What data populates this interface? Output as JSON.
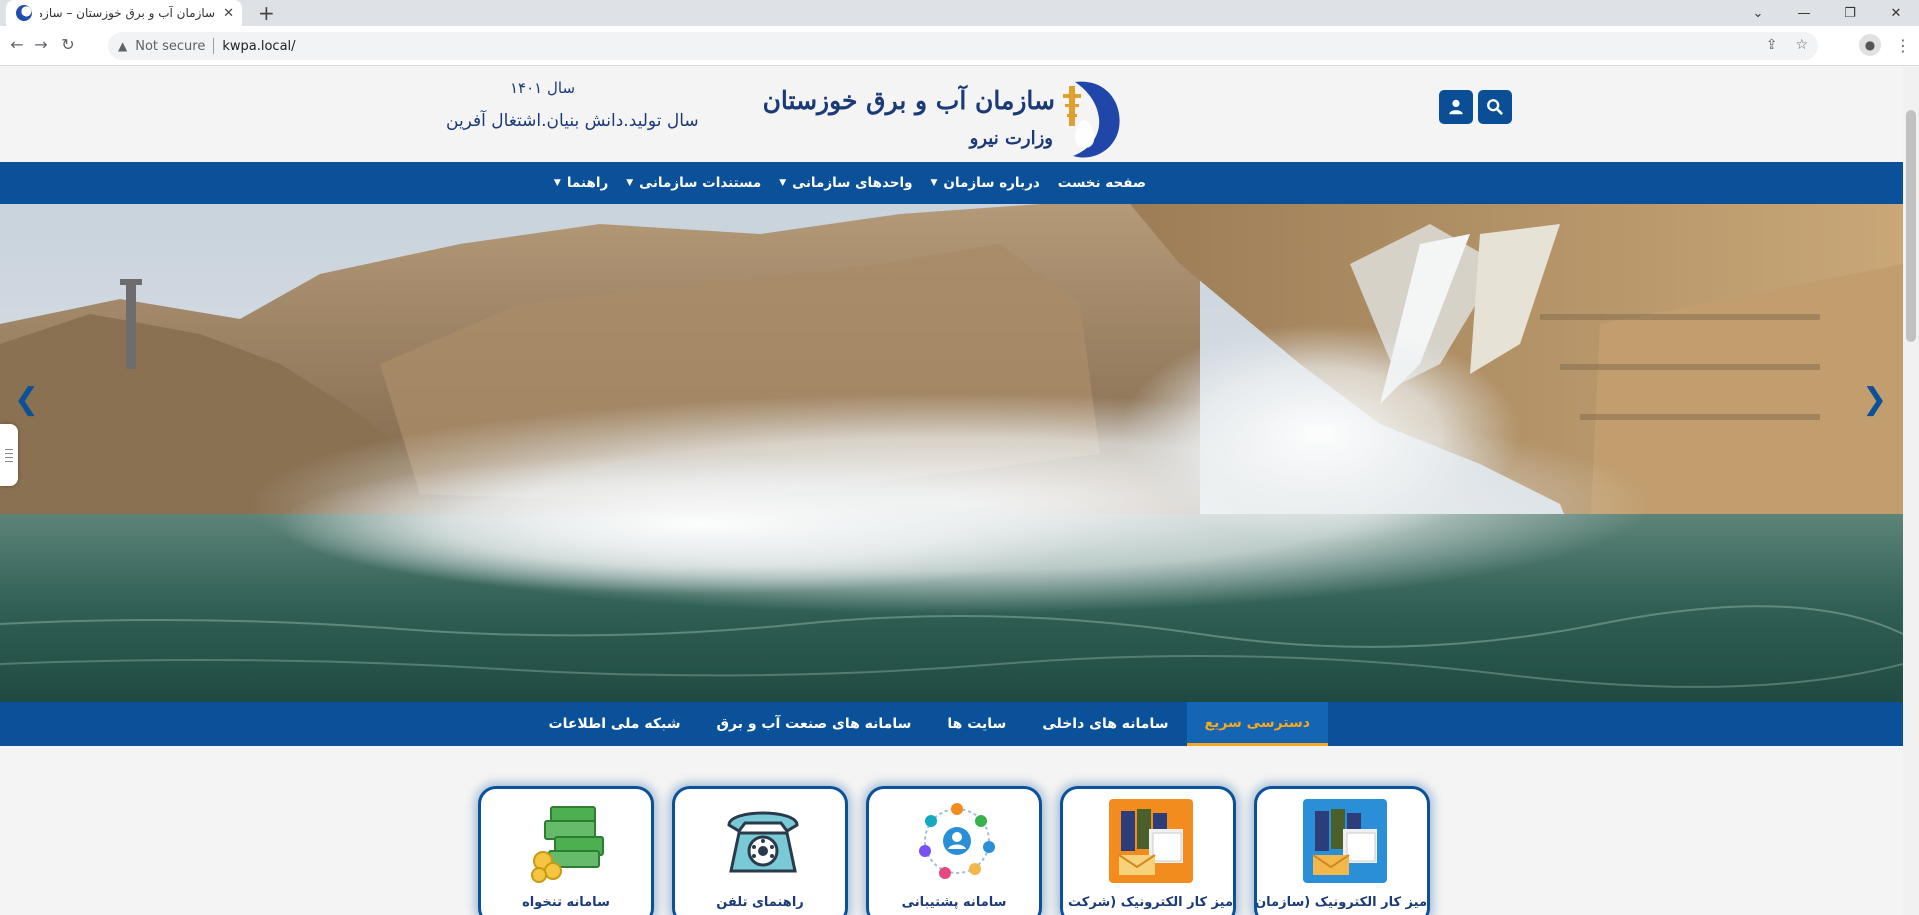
{
  "browser": {
    "tab_title": "سازمان آب و برق خوزستان – سازمان آب و برق خوزستان",
    "tab_close": "✕",
    "new_tab": "+",
    "security_label": "Not secure",
    "url": "kwpa.local/",
    "window_controls": [
      "⌄",
      "—",
      "❐",
      "✕"
    ]
  },
  "header": {
    "org_name": "سازمان آب و برق خوزستان",
    "ministry": "وزارت نیرو",
    "year": "سال ۱۴۰۱",
    "year_motto": "سال تولید.دانش بنیان.اشتغال آفرین",
    "brand_color": "#0a519a"
  },
  "main_nav": {
    "items": [
      {
        "label": "صفحه نخست",
        "dropdown": false
      },
      {
        "label": "درباره سازمان",
        "dropdown": true
      },
      {
        "label": "واحدهای سازمانی",
        "dropdown": true
      },
      {
        "label": "مستندات سازمانی",
        "dropdown": true
      },
      {
        "label": "راهنما",
        "dropdown": true
      }
    ],
    "caret": "▼"
  },
  "slider": {
    "prev": "❮",
    "next": "❯"
  },
  "quick_tabs": {
    "items": [
      "دسترسی سریع",
      "سامانه های داخلی",
      "سایت ها",
      "سامانه های صنعت آب و برق",
      "شبکه ملی اطلاعات"
    ],
    "active_index": 0,
    "active_color": "#f5a623"
  },
  "cards": [
    {
      "label": "میز کار الکترونیک (سازمان)",
      "icon": "office-folders-icon"
    },
    {
      "label": "میز کار الکترونیک (شرکت ها)",
      "icon": "office-folders-orange-icon"
    },
    {
      "label": "سامانه پشتیبانی",
      "icon": "support-network-icon"
    },
    {
      "label": "راهنمای تلفن",
      "icon": "telephone-icon"
    },
    {
      "label": "سامانه تنخواه",
      "icon": "money-stack-icon"
    }
  ]
}
